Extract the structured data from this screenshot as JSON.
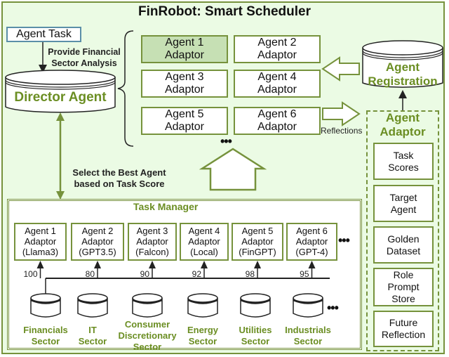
{
  "title": "FinRobot: Smart Scheduler",
  "agent_task": {
    "label": "Agent Task",
    "arrow_label_line1": "Provide Financial",
    "arrow_label_line2": "Sector Analysis"
  },
  "director_agent": {
    "label": "Director Agent"
  },
  "agent_pool": {
    "agents": [
      {
        "line1": "Agent 1",
        "line2": "Adaptor",
        "selected": true
      },
      {
        "line1": "Agent 2",
        "line2": "Adaptor",
        "selected": false
      },
      {
        "line1": "Agent 3",
        "line2": "Adaptor",
        "selected": false
      },
      {
        "line1": "Agent 4",
        "line2": "Adaptor",
        "selected": false
      },
      {
        "line1": "Agent 5",
        "line2": "Adaptor",
        "selected": false
      },
      {
        "line1": "Agent 6",
        "line2": "Adaptor",
        "selected": false
      }
    ],
    "more": "•••"
  },
  "agent_registration": {
    "line1": "Agent",
    "line2": "Registration"
  },
  "reflections_label": "Reflections",
  "select_label": {
    "line1": "Select the Best Agent",
    "line2": "based on Task Score"
  },
  "task_manager": {
    "title": "Task Manager",
    "agents": [
      {
        "line1": "Agent 1",
        "line2": "Adaptor",
        "line3": "(Llama3)",
        "score": "100"
      },
      {
        "line1": "Agent 2",
        "line2": "Adaptor",
        "line3": "(GPT3.5)",
        "score": "80"
      },
      {
        "line1": "Agent 3",
        "line2": "Adaptor",
        "line3": "(Falcon)",
        "score": "90"
      },
      {
        "line1": "Agent 4",
        "line2": "Adaptor",
        "line3": "(Local)",
        "score": "92"
      },
      {
        "line1": "Agent 5",
        "line2": "Adaptor",
        "line3": "(FinGPT)",
        "score": "98"
      },
      {
        "line1": "Agent 6",
        "line2": "Adaptor",
        "line3": "(GPT-4)",
        "score": "95"
      }
    ],
    "more": "•••",
    "sectors": [
      {
        "lines": [
          "Financials",
          "Sector"
        ]
      },
      {
        "lines": [
          "IT",
          "Sector"
        ]
      },
      {
        "lines": [
          "Consumer",
          "Discretionary",
          "Sector"
        ]
      },
      {
        "lines": [
          "Energy",
          "Sector"
        ]
      },
      {
        "lines": [
          "Utilities",
          "Sector"
        ]
      },
      {
        "lines": [
          "Industrials",
          "Sector"
        ]
      }
    ],
    "sectors_more": "•••"
  },
  "agent_adaptor": {
    "title_line1": "Agent",
    "title_line2": "Adaptor",
    "items": [
      {
        "lines": [
          "Task",
          "Scores"
        ]
      },
      {
        "lines": [
          "Target",
          "Agent"
        ]
      },
      {
        "lines": [
          "Golden",
          "Dataset"
        ]
      },
      {
        "lines": [
          "Role",
          "Prompt",
          "Store"
        ]
      },
      {
        "lines": [
          "Future",
          "Reflection"
        ]
      }
    ]
  },
  "colors": {
    "accent_green": "#76923c",
    "text_green": "#6b8e23",
    "background": "#ebfbe4",
    "selected_fill": "#c6e0b4",
    "task_border": "#5b8fa8"
  }
}
